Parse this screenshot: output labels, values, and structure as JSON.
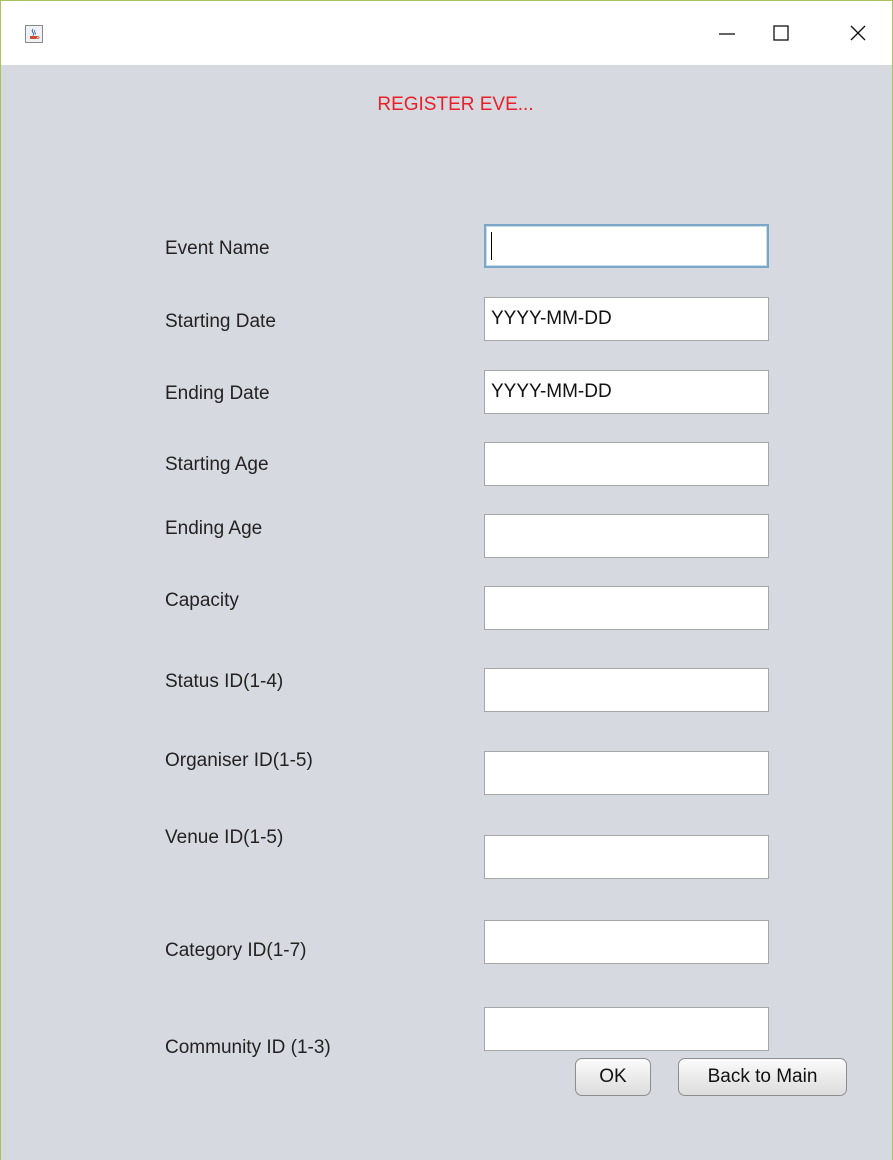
{
  "window": {
    "title": "",
    "heading": "REGISTER EVE..."
  },
  "titlebar": {
    "icons": [
      "java-cup-icon",
      "minimize-icon",
      "maximize-icon",
      "close-icon"
    ]
  },
  "form": {
    "fields": [
      {
        "label": "Event Name",
        "value": "",
        "focused": true
      },
      {
        "label": "Starting Date",
        "value": "YYYY-MM-DD"
      },
      {
        "label": "Ending Date",
        "value": "YYYY-MM-DD"
      },
      {
        "label": "Starting Age",
        "value": ""
      },
      {
        "label": "Ending Age",
        "value": ""
      },
      {
        "label": "Capacity",
        "value": ""
      },
      {
        "label": "Status ID(1-4)",
        "value": ""
      },
      {
        "label": "Organiser ID(1-5)",
        "value": ""
      },
      {
        "label": "Venue ID(1-5)",
        "value": ""
      },
      {
        "label": "Category ID(1-7)",
        "value": ""
      },
      {
        "label": "Community ID (1-3)",
        "value": ""
      }
    ]
  },
  "buttons": {
    "ok": "OK",
    "back": "Back to Main"
  },
  "colors": {
    "heading": "#e8202a",
    "background": "#d6d9df",
    "titlebar": "#ffffff",
    "focus_border": "#7aa7c7"
  }
}
